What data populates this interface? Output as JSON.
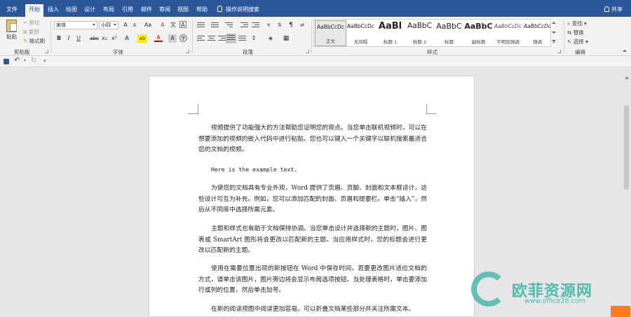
{
  "tabs": [
    {
      "label": "文件",
      "active": false
    },
    {
      "label": "开始",
      "active": true
    },
    {
      "label": "插入",
      "active": false
    },
    {
      "label": "绘图",
      "active": false
    },
    {
      "label": "设计",
      "active": false
    },
    {
      "label": "布局",
      "active": false
    },
    {
      "label": "引用",
      "active": false
    },
    {
      "label": "邮件",
      "active": false
    },
    {
      "label": "审阅",
      "active": false
    },
    {
      "label": "视图",
      "active": false
    },
    {
      "label": "帮助",
      "active": false
    }
  ],
  "tell_me": "操作说明搜索",
  "share": "共享",
  "clipboard": {
    "paste": "粘贴",
    "cut": "剪切",
    "copy": "复制",
    "format_painter": "格式刷",
    "label": "剪贴板"
  },
  "font": {
    "name": "宋体",
    "size": "小四",
    "label": "字体",
    "grow": "A",
    "shrink": "A",
    "case": "Aa",
    "clear": "A",
    "phonetic": "文",
    "border": "A",
    "bold": "B",
    "italic": "I",
    "underline": "U",
    "strike": "abc",
    "subscript": "x₂",
    "superscript": "x²",
    "effects": "A",
    "highlight": "ab",
    "color": "A",
    "shade": "A",
    "encircle": "字"
  },
  "paragraph": {
    "label": "段落"
  },
  "styles": {
    "label": "样式",
    "items": [
      {
        "sample": "AaBbCcDc",
        "name": "正文",
        "selected": true
      },
      {
        "sample": "AaBbCcDc",
        "name": "无间隔",
        "selected": false
      },
      {
        "sample": "AaBl",
        "name": "标题 1",
        "selected": false
      },
      {
        "sample": "AaBbC",
        "name": "标题 2",
        "selected": false
      },
      {
        "sample": "AaBbC",
        "name": "标题",
        "selected": false
      },
      {
        "sample": "AaBbC",
        "name": "副标题",
        "selected": false
      },
      {
        "sample": "AaBbCcDc",
        "name": "不明显强调",
        "selected": false
      },
      {
        "sample": "AaBbCcDc",
        "name": "强调",
        "selected": false
      }
    ]
  },
  "editing": {
    "find": "查找",
    "replace": "替换",
    "select": "选择",
    "label": "编辑"
  },
  "document": {
    "paragraphs": [
      "视频提供了功能强大的方法帮助您证明您的观点。当您单击联机视频时，可以在想要添加的视频的嵌入代码中进行粘贴。您也可以键入一个关键字以联机搜索最适合您的文档的视频。",
      "Here is the example text.",
      "为使您的文档具有专业外观，Word 提供了页眉、页脚、封面和文本框设计，这些设计可互为补充。例如，您可以添加匹配的封面、页眉和提要栏。单击“插入”，然后从不同库中选择所需元素。",
      "主题和样式也有助于文档保持协调。当您单击设计并选择新的主题时，图片、图表或 SmartArt 图形将会更改以匹配新的主题。当应用样式时，您的标题会进行更改以匹配新的主题。",
      "使用在需要位置出现的新按钮在 Word 中保存时间。若要更改图片适应文档的方式，请单击该图片，图片旁边将会显示布局选项按钮。当处理表格时，单击要添加行或列的位置，然后单击加号。",
      "在新的阅读视图中阅读更加容易。可以折叠文档某些部分并关注所需文本。"
    ]
  },
  "watermark": {
    "text": "欧菲资源网",
    "url": "www.office26.com"
  },
  "colors": {
    "accent": "#2b579a",
    "watermark": "#34b3a8",
    "badge": "#ff7a1a"
  }
}
